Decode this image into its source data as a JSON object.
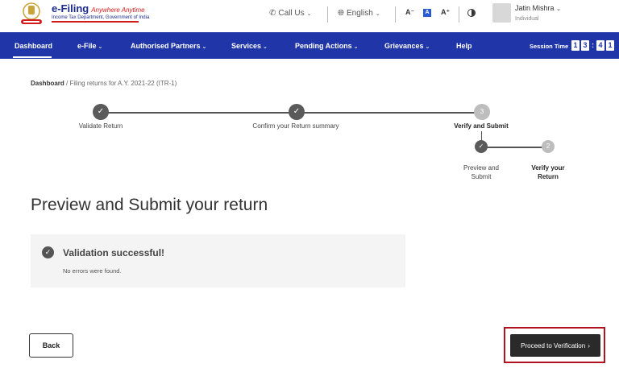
{
  "header": {
    "logo_title": "e-Filing",
    "logo_tagline": "Anywhere Anytime",
    "logo_subtitle": "Income Tax Department, Government of India",
    "call_us": "Call Us",
    "language": "English",
    "font_decrease": "A⁻",
    "font_default": "A",
    "font_increase": "A⁺",
    "user_name": "Jatin Mishra",
    "user_role": "Individual"
  },
  "nav": {
    "items": [
      {
        "label": "Dashboard",
        "has_chevron": false
      },
      {
        "label": "e-File",
        "has_chevron": true
      },
      {
        "label": "Authorised Partners",
        "has_chevron": true
      },
      {
        "label": "Services",
        "has_chevron": true
      },
      {
        "label": "Pending Actions",
        "has_chevron": true
      },
      {
        "label": "Grievances",
        "has_chevron": true
      },
      {
        "label": "Help",
        "has_chevron": false
      }
    ],
    "session_label": "Session Time",
    "session_digits": [
      "1",
      "3",
      "4",
      "1"
    ],
    "accent_color": "#2036a8"
  },
  "breadcrumb": {
    "root": "Dashboard",
    "current": "/ Filing returns for A.Y. 2021-22 (ITR-1)"
  },
  "stepper": {
    "steps": [
      {
        "label": "Validate Return",
        "state": "done"
      },
      {
        "label": "Confirm your Return summary",
        "state": "done"
      },
      {
        "label": "Verify and Submit",
        "state": "current",
        "number": "3"
      }
    ],
    "substeps": [
      {
        "label_line1": "Preview and",
        "label_line2": "Submit",
        "state": "done"
      },
      {
        "label_line1": "Verify your",
        "label_line2": "Return",
        "state": "pending",
        "number": "2"
      }
    ]
  },
  "main": {
    "title": "Preview and Submit your return",
    "validation_title": "Validation successful!",
    "validation_message": "No errors were found."
  },
  "actions": {
    "back_label": "Back",
    "proceed_label": "Proceed to Verification",
    "highlight_color": "#b3121f"
  }
}
